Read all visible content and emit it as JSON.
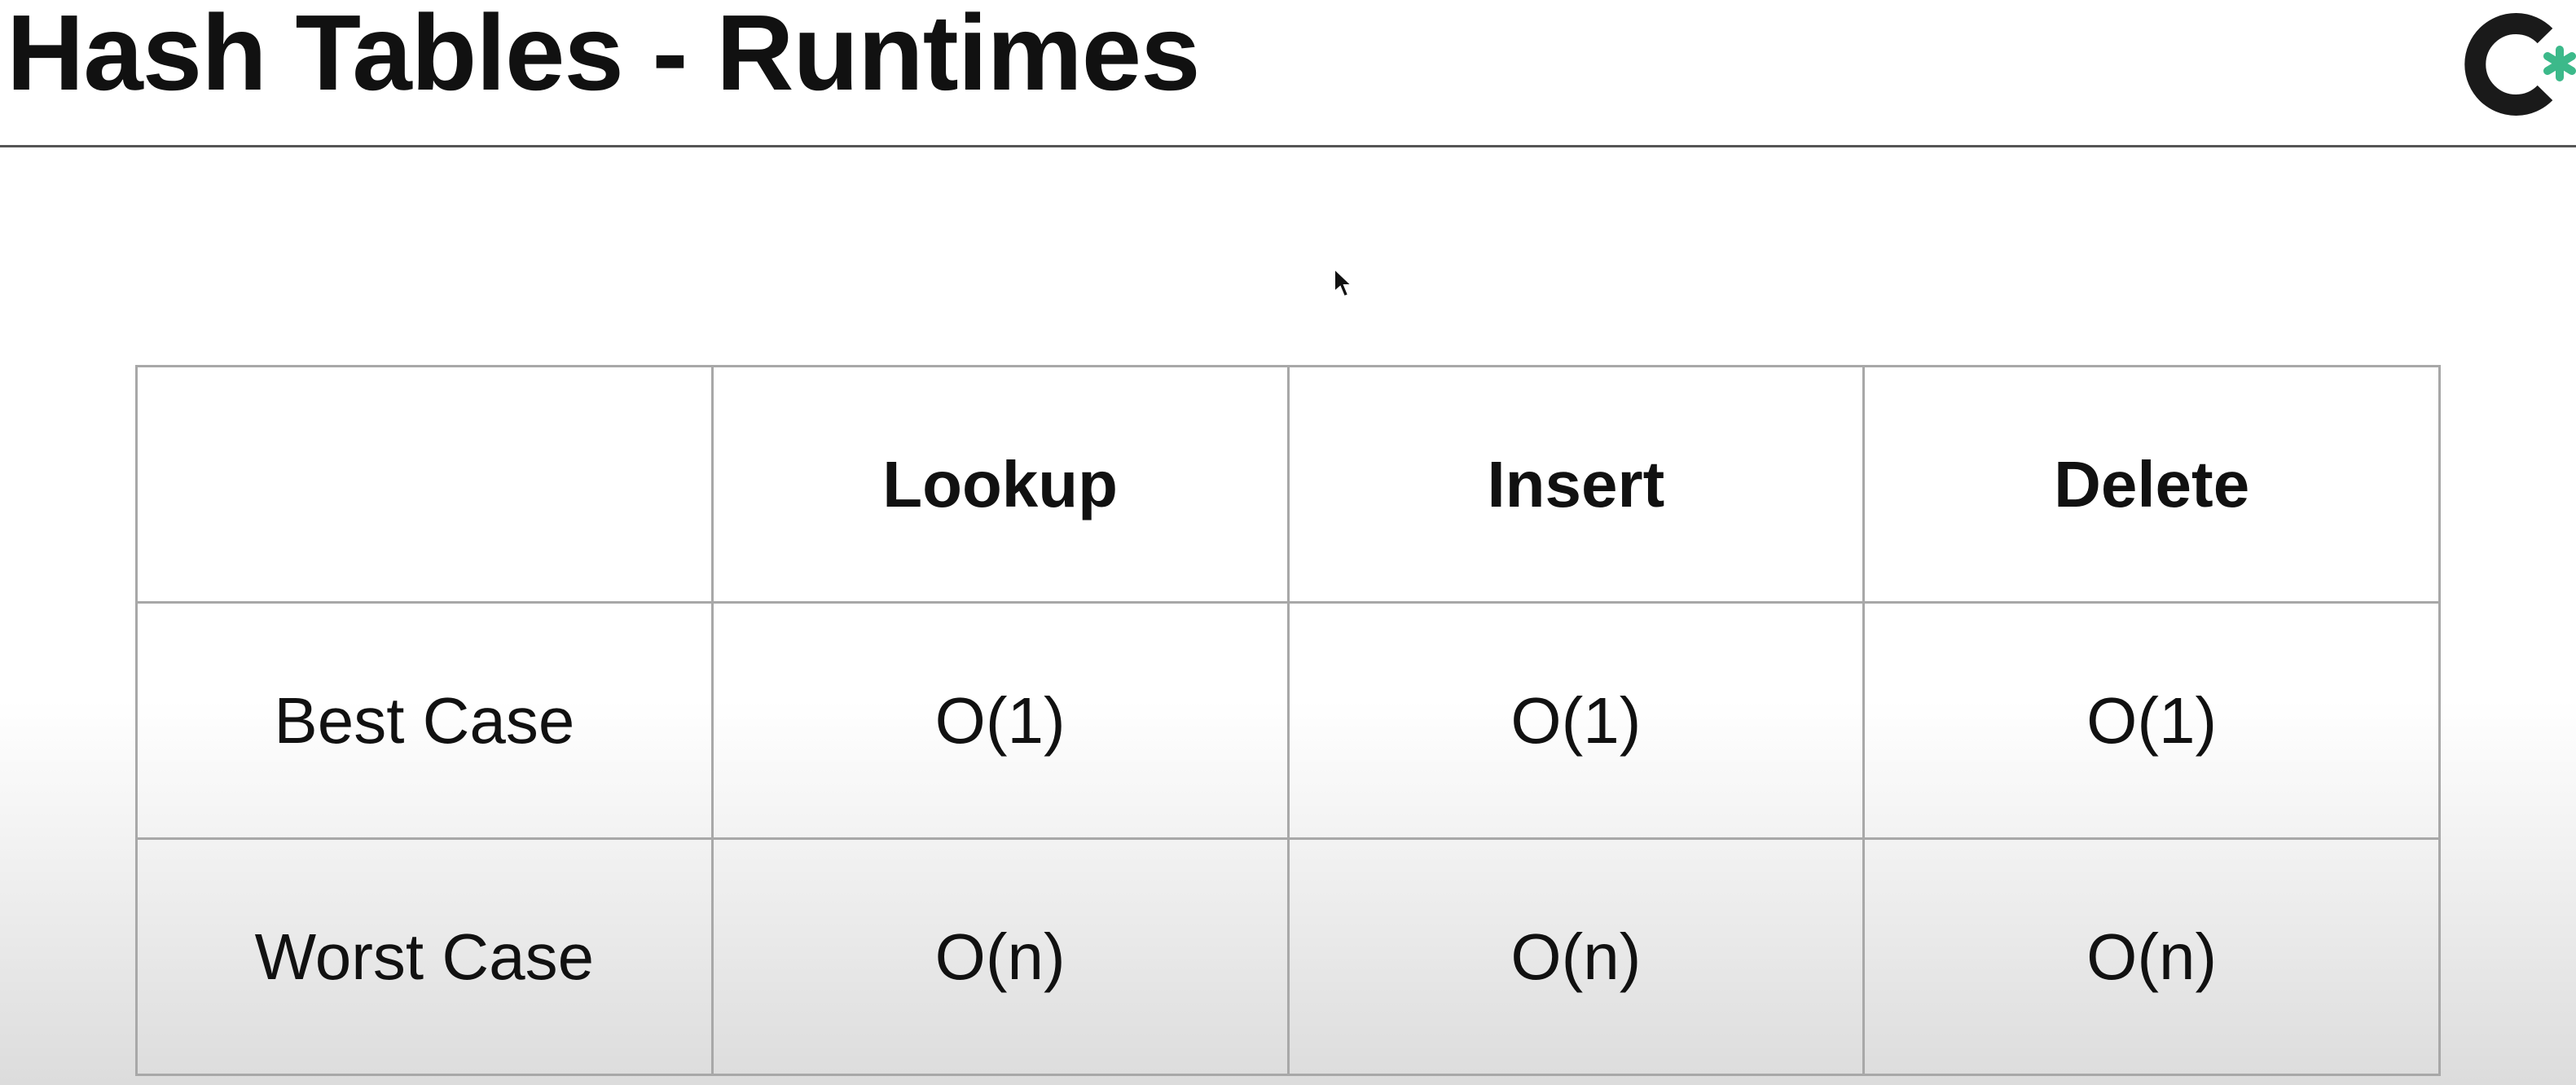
{
  "slide": {
    "title": "Hash Tables - Runtimes"
  },
  "logo": {
    "letter": "C",
    "mark": "*",
    "letter_color": "#1a1a1a",
    "mark_color": "#3cb98a"
  },
  "table": {
    "columns": [
      "",
      "Lookup",
      "Insert",
      "Delete"
    ],
    "rows": [
      {
        "label": "Best Case",
        "values": [
          "O(1)",
          "O(1)",
          "O(1)"
        ]
      },
      {
        "label": "Worst Case",
        "values": [
          "O(n)",
          "O(n)",
          "O(n)"
        ]
      }
    ]
  },
  "colors": {
    "title": "#111111",
    "grid_line": "#a8a8a8",
    "rule": "#555555"
  }
}
